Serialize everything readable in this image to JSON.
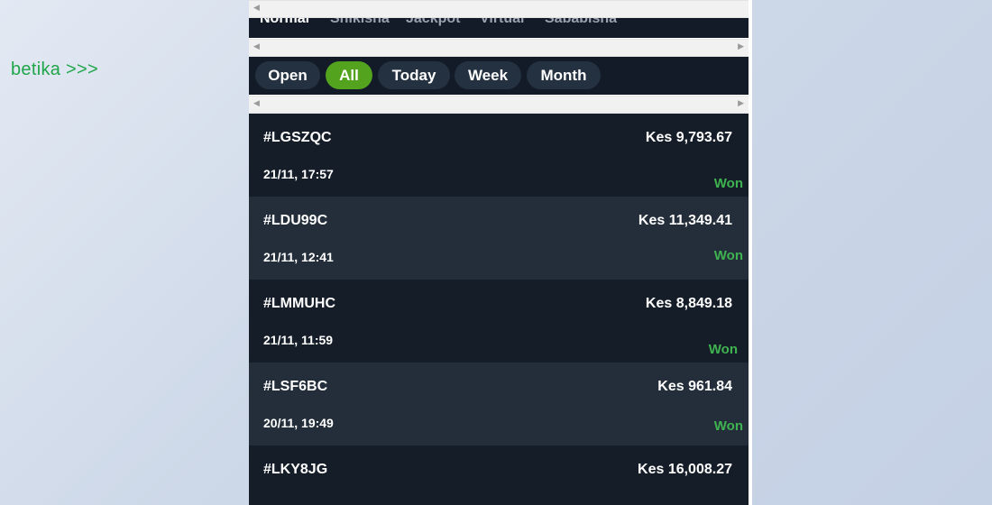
{
  "side_link": {
    "label": "betika >>>"
  },
  "tabs": [
    {
      "label": "Normal",
      "active": true
    },
    {
      "label": "Shikisha",
      "active": false
    },
    {
      "label": "Jackpot",
      "active": false
    },
    {
      "label": "Virtual",
      "active": false
    },
    {
      "label": "Sababisha",
      "active": false
    }
  ],
  "filters": [
    {
      "label": "Open",
      "active": false
    },
    {
      "label": "All",
      "active": true
    },
    {
      "label": "Today",
      "active": false
    },
    {
      "label": "Week",
      "active": false
    },
    {
      "label": "Month",
      "active": false
    }
  ],
  "bets": [
    {
      "id": "#LGSZQC",
      "amount": "Kes 9,793.67",
      "time": "21/11, 17:57",
      "status": "Won"
    },
    {
      "id": "#LDU99C",
      "amount": "Kes 11,349.41",
      "time": "21/11, 12:41",
      "status": "Won"
    },
    {
      "id": "#LMMUHC",
      "amount": "Kes 8,849.18",
      "time": "21/11, 11:59",
      "status": "Won"
    },
    {
      "id": "#LSF6BC",
      "amount": "Kes 961.84",
      "time": "20/11, 19:49",
      "status": "Won"
    },
    {
      "id": "#LKY8JG",
      "amount": "Kes 16,008.27",
      "time": "",
      "status": ""
    }
  ],
  "scrollbar_icons": {
    "left": "arrow-left-icon",
    "right": "arrow-right-icon"
  },
  "colors": {
    "page_bg": "#cdd8e8",
    "panel_bg": "#121b27",
    "row_dark": "#151d28",
    "row_light": "#232e3a",
    "accent_green": "#53a31f",
    "won_green": "#3fb34f",
    "link_green": "#1fa54a"
  }
}
